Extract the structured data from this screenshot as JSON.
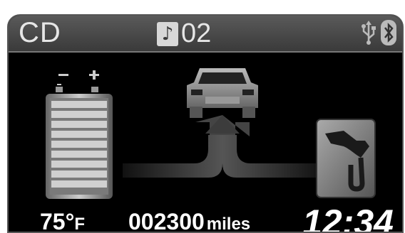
{
  "header": {
    "source": "CD",
    "track_icon": "music-note-icon",
    "track_number": "02",
    "usb_icon": "usb-icon",
    "bluetooth_icon": "bluetooth-icon"
  },
  "status": {
    "temperature_value": "75°",
    "temperature_unit": "F",
    "odometer_value": "002300",
    "odometer_unit": "miles",
    "clock": "12:34"
  },
  "colors": {
    "background": "#000000",
    "topbar": "#4a4a4a",
    "text": "#ffffff"
  }
}
